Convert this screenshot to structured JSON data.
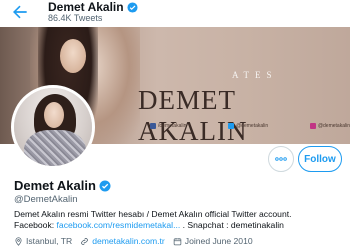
{
  "header": {
    "name": "Demet Akalin",
    "tweet_count": "86.4K Tweets"
  },
  "banner": {
    "subtitle": "ATES",
    "title": "DEMET AKALIN",
    "socials": [
      {
        "icon": "facebook-icon",
        "handle": "/demetakalin",
        "color": "#3b5998"
      },
      {
        "icon": "twitter-icon",
        "handle": "@demetakalin",
        "color": "#1d9bf0"
      },
      {
        "icon": "instagram-icon",
        "handle": "@demetakalin",
        "color": "#c13584"
      }
    ]
  },
  "actions": {
    "more_label": "···",
    "follow_label": "Follow"
  },
  "profile": {
    "name": "Demet Akalin",
    "handle": "@DemetAkalin",
    "bio_line1": "Demet Akalın resmi Twitter hesabı / Demet Akalın official Twitter account.",
    "bio_prefix": "Facebook:",
    "bio_link": "facebook.com/resmidemetakal...",
    "bio_suffix": ". Snapchat : demetinakalin",
    "location": "Istanbul, TR",
    "website": "demetakalin.com.tr",
    "joined": "Joined June 2010"
  },
  "colors": {
    "accent": "#1d9bf0",
    "secondary_text": "#536471"
  }
}
